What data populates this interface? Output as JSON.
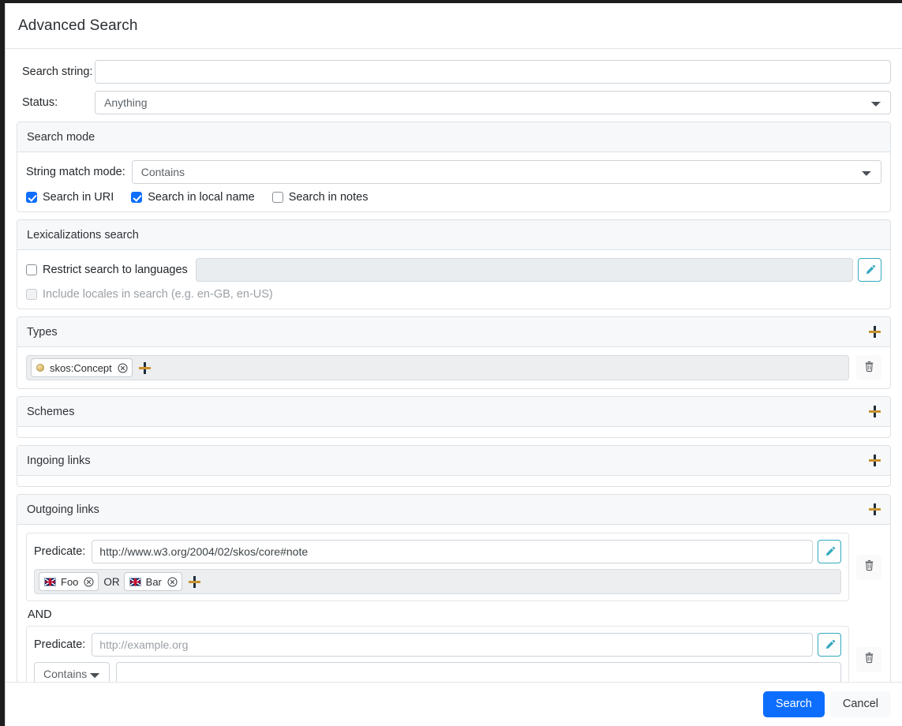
{
  "dialog": {
    "title": "Advanced Search"
  },
  "search_string": {
    "label": "Search string:",
    "value": "",
    "placeholder": ""
  },
  "status": {
    "label": "Status:",
    "selected": "Anything",
    "options": [
      "Anything"
    ]
  },
  "search_mode": {
    "title": "Search mode",
    "string_match_label": "String match mode:",
    "string_match_selected": "Contains",
    "string_match_options": [
      "Contains"
    ],
    "checkboxes": [
      {
        "label": "Search in URI",
        "checked": true
      },
      {
        "label": "Search in local name",
        "checked": true
      },
      {
        "label": "Search in notes",
        "checked": false
      }
    ]
  },
  "lexicalizations": {
    "title": "Lexicalizations search",
    "restrict_label": "Restrict search to languages",
    "restrict_checked": false,
    "languages_value": "",
    "edit_icon": "pencil-icon",
    "locales_label": "Include locales in search (e.g. en-GB, en-US)",
    "locales_checked": false,
    "locales_disabled": true
  },
  "types": {
    "title": "Types",
    "add_icon": "plus-icon",
    "chips": [
      {
        "label": "skos:Concept",
        "icon": "class-dot-icon",
        "remove_icon": "remove-circle-icon"
      }
    ],
    "inline_add_icon": "plus-icon",
    "delete_icon": "trash-icon"
  },
  "schemes": {
    "title": "Schemes",
    "add_icon": "plus-icon",
    "chips": []
  },
  "ingoing_links": {
    "title": "Ingoing links",
    "add_icon": "plus-icon",
    "rows": []
  },
  "outgoing_links": {
    "title": "Outgoing links",
    "add_icon": "plus-icon",
    "conjunction": "AND",
    "rows": [
      {
        "predicate_label": "Predicate:",
        "predicate_value": "http://www.w3.org/2004/02/skos/core#note",
        "predicate_is_placeholder": false,
        "edit_icon": "pencil-icon",
        "delete_icon": "trash-icon",
        "value_kind": "chips",
        "chips": [
          {
            "label": "Foo",
            "icon": "flag-en-icon",
            "remove_icon": "remove-circle-icon"
          },
          {
            "label": "Bar",
            "icon": "flag-en-icon",
            "remove_icon": "remove-circle-icon"
          }
        ],
        "chip_separator": "OR",
        "inline_add_icon": "plus-icon"
      },
      {
        "predicate_label": "Predicate:",
        "predicate_value": "http://example.org",
        "predicate_is_placeholder": true,
        "edit_icon": "pencil-icon",
        "delete_icon": "trash-icon",
        "value_kind": "select",
        "match_selected": "Contains",
        "match_options": [
          "Contains"
        ],
        "value_text": "",
        "value_placeholder": ""
      }
    ]
  },
  "footer": {
    "search_label": "Search",
    "cancel_label": "Cancel"
  },
  "colors": {
    "primary": "#0d6efd",
    "panel_header_bg": "#f7f8f9",
    "border": "#dee2e6",
    "accent_teal": "#35a9bf",
    "plus_gold": "#c9932f",
    "chipbar_bg": "#eceef0"
  }
}
